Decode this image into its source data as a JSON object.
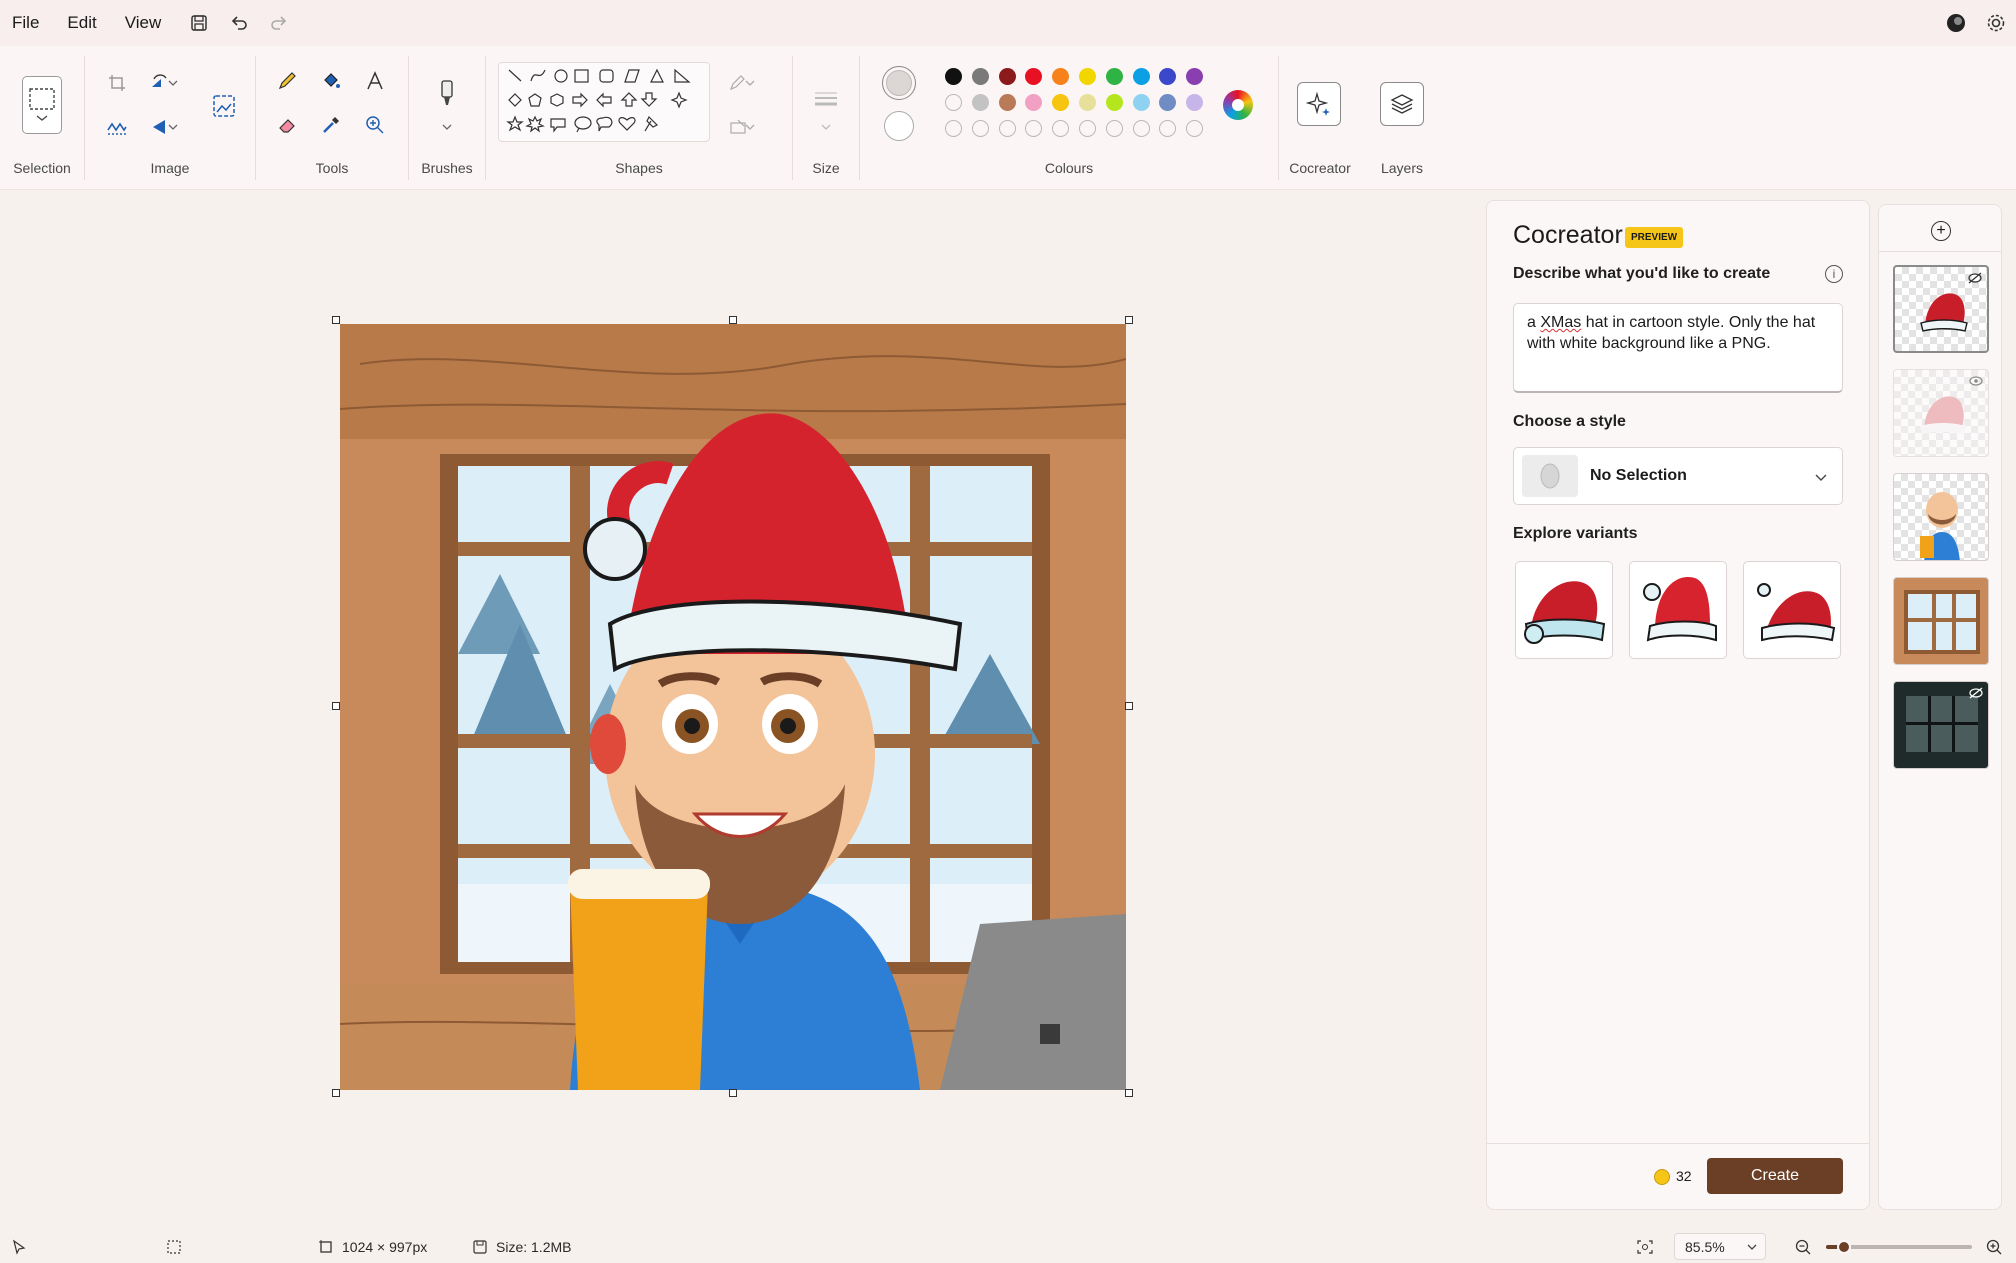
{
  "menubar": {
    "file": "File",
    "edit": "Edit",
    "view": "View"
  },
  "ribbon": {
    "groups": {
      "selection": "Selection",
      "image": "Image",
      "tools": "Tools",
      "brushes": "Brushes",
      "shapes": "Shapes",
      "size": "Size",
      "colours": "Colours",
      "cocreator": "Cocreator",
      "layers": "Layers"
    },
    "colors_row1": [
      "#111111",
      "#7a7a7a",
      "#8b1a1a",
      "#e81123",
      "#f7821b",
      "#f2d600",
      "#2fb344",
      "#0aa0e3",
      "#3b48cc",
      "#8a3fb0"
    ],
    "colors_row2": [
      "#ffffff",
      "#c3c3c3",
      "#b97a57",
      "#f2a0c4",
      "#f7c510",
      "#e6e09a",
      "#b5e61d",
      "#8ed1f0",
      "#6f8cc4",
      "#c7b4e8"
    ],
    "primary_color": "#dcd6d4",
    "secondary_color": "#ffffff"
  },
  "cocreator": {
    "title": "Cocreator",
    "badge": "PREVIEW",
    "describe_label": "Describe what you'd like to create",
    "prompt_word1": "a ",
    "prompt_misspelled": "XMas",
    "prompt_rest": " hat in cartoon style. Only the hat with white background like a PNG.",
    "style_label": "Choose a style",
    "style_value": "No Selection",
    "variants_label": "Explore variants",
    "credits": "32",
    "create_button": "Create"
  },
  "status": {
    "dimensions": "1024 × 997px",
    "size": "Size: 1.2MB",
    "zoom": "85.5%",
    "zoom_level": 0.12
  }
}
